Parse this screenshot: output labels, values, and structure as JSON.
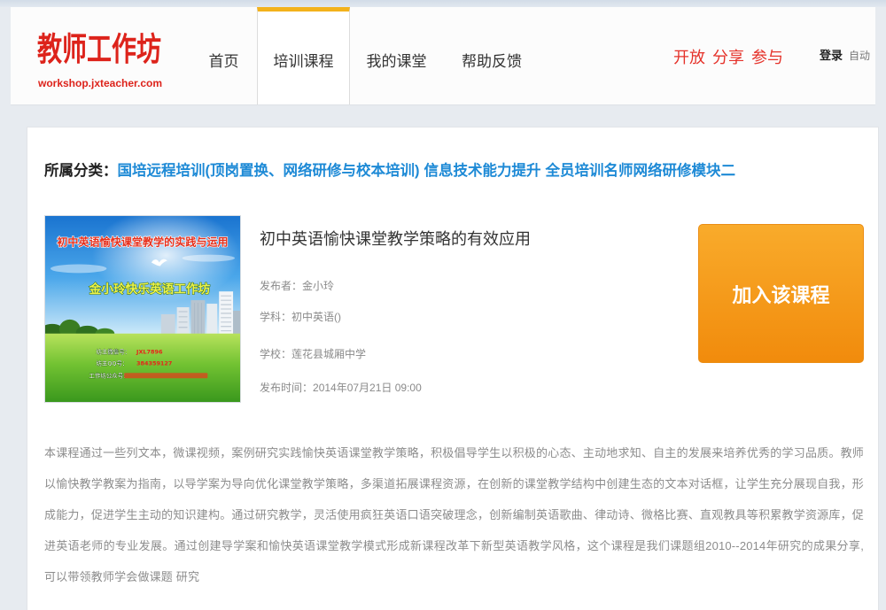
{
  "header": {
    "logo": {
      "title": "教师工作坊",
      "domain": "workshop.jxteacher.com"
    },
    "nav": [
      {
        "label": "首页",
        "active": false
      },
      {
        "label": "培训课程",
        "active": true
      },
      {
        "label": "我的课堂",
        "active": false
      },
      {
        "label": "帮助反馈",
        "active": false
      }
    ],
    "slogan": "开放 分享 参与",
    "login_label": "登录",
    "auto_label": "自动"
  },
  "course": {
    "category_label": "所属分类：",
    "categories": [
      "国培远程培训(顶岗置换、网络研修与校本培训)",
      "信息技术能力提升",
      "全员培训名师网络研修模块二"
    ],
    "thumbnail": {
      "headline": "初中英语愉快课堂教学的实践与运用",
      "workshop_name": "金小玲快乐英语工作坊",
      "info": [
        {
          "label": "坊主微信号：",
          "value": "JXL7896"
        },
        {
          "label": "坊主QQ号：",
          "value": "384359127"
        },
        {
          "label": "工作坊公众号："
        }
      ]
    },
    "title": "初中英语愉快课堂教学策略的有效应用",
    "meta": [
      {
        "label": "发布者：",
        "value": "金小玲"
      },
      {
        "label": "学科：",
        "value": "初中英语()"
      },
      {
        "label": "学校：",
        "value": "莲花县城厢中学"
      },
      {
        "label": "发布时间：",
        "value": "2014年07月21日 09:00"
      }
    ],
    "join_button_label": "加入该课程",
    "description": "本课程通过一些列文本，微课视频，案例研究实践愉快英语课堂教学策略，积极倡导学生以积极的心态、主动地求知、自主的发展来培养优秀的学习品质。教师以愉快教学教案为指南，以导学案为导向优化课堂教学策略，多渠道拓展课程资源，在创新的课堂教学结构中创建生态的文本对话框，让学生充分展现自我，形成能力，促进学生主动的知识建构。通过研究教学，灵活使用疯狂英语口语突破理念，创新编制英语歌曲、律动诗、微格比赛、直观教具等积累教学资源库，促进英语老师的专业发展。通过创建导学案和愉快英语课堂教学模式形成新课程改革下新型英语教学风格，这个课程是我们课题组2010--2014年研究的成果分享,可以带领教师学会做课题 研究"
  },
  "colors": {
    "brand_red": "#dd231b",
    "slogan_red": "#e5322a",
    "link_blue": "#1e8ad6",
    "tab_accent": "#f3b21c",
    "button_top": "#f9ab2b",
    "button_bottom": "#f18b0c"
  }
}
